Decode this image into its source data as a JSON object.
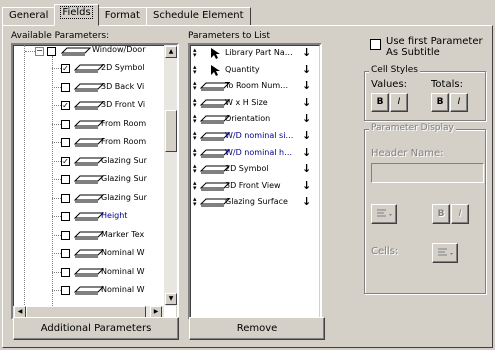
{
  "tabs": [
    {
      "label": "General",
      "active": false
    },
    {
      "label": "Fields",
      "active": true
    },
    {
      "label": "Format",
      "active": false
    },
    {
      "label": "Schedule Element",
      "active": false
    }
  ],
  "available": {
    "label": "Available Parameters:",
    "parent_node": "Window/Door",
    "items": [
      {
        "label": "2D Symbol",
        "checked": true,
        "color": "#000000"
      },
      {
        "label": "3D Back Vi",
        "checked": false,
        "color": "#000000"
      },
      {
        "label": "3D Front Vi",
        "checked": true,
        "color": "#000000"
      },
      {
        "label": "From Room",
        "checked": false,
        "color": "#000000"
      },
      {
        "label": "From Room",
        "checked": false,
        "color": "#000000"
      },
      {
        "label": "Glazing Sur",
        "checked": true,
        "color": "#000000"
      },
      {
        "label": "Glazing Sur",
        "checked": false,
        "color": "#000000"
      },
      {
        "label": "Glazing Sur",
        "checked": false,
        "color": "#000000"
      },
      {
        "label": "Height",
        "checked": false,
        "color": "#00008b"
      },
      {
        "label": "Marker Tex",
        "checked": false,
        "color": "#000000"
      },
      {
        "label": "Nominal W",
        "checked": false,
        "color": "#000000"
      },
      {
        "label": "Nominal W",
        "checked": false,
        "color": "#000000"
      },
      {
        "label": "Nominal W",
        "checked": false,
        "color": "#000000"
      }
    ]
  },
  "list": {
    "label": "Parameters to List",
    "items": [
      {
        "label": "Library Part Na…",
        "icon": "cursor",
        "color": "#000000"
      },
      {
        "label": "Quantity",
        "icon": "cursor",
        "color": "#000000"
      },
      {
        "label": "To Room Num…",
        "icon": "element",
        "color": "#000000"
      },
      {
        "label": "W x H Size",
        "icon": "element",
        "color": "#000000"
      },
      {
        "label": "Orientation",
        "icon": "element",
        "color": "#000000"
      },
      {
        "label": "W/D nominal si…",
        "icon": "element",
        "color": "#00008b"
      },
      {
        "label": "W/D nominal h…",
        "icon": "element",
        "color": "#00008b"
      },
      {
        "label": "2D Symbol",
        "icon": "element",
        "color": "#000000"
      },
      {
        "label": "3D Front View",
        "icon": "element",
        "color": "#000000"
      },
      {
        "label": "Glazing Surface",
        "icon": "element",
        "color": "#000000"
      }
    ]
  },
  "buttons": {
    "additional": "Additional Parameters",
    "remove": "Remove"
  },
  "options": {
    "use_first_line1": "Use first Parameter",
    "use_first_line2": "As Subtitle",
    "use_first_checked": false
  },
  "cell_styles": {
    "title": "Cell Styles",
    "values_label": "Values:",
    "totals_label": "Totals:",
    "bold": "B",
    "italic": "I"
  },
  "param_display": {
    "title": "Parameter Display",
    "header_name_label": "Header Name:",
    "header_name_value": "",
    "cells_label": "Cells:",
    "bold": "B",
    "italic": "I"
  }
}
